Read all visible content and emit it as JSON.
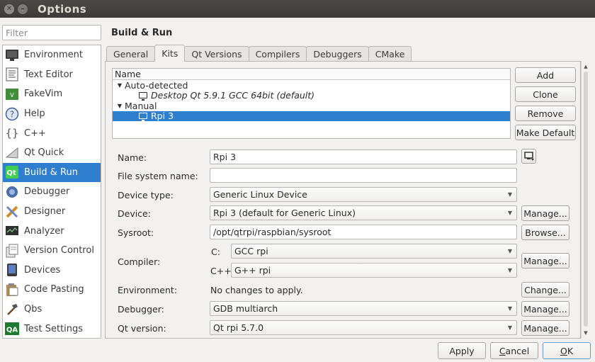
{
  "window": {
    "title": "Options",
    "close_glyph": "✕",
    "minimize_glyph": "–"
  },
  "filter": {
    "placeholder": "Filter"
  },
  "sidebar": {
    "items": [
      {
        "label": "Environment",
        "icon": "monitor-icon"
      },
      {
        "label": "Text Editor",
        "icon": "text-document-icon"
      },
      {
        "label": "FakeVim",
        "icon": "fakevim-icon"
      },
      {
        "label": "Help",
        "icon": "help-icon"
      },
      {
        "label": "C++",
        "icon": "braces-icon"
      },
      {
        "label": "Qt Quick",
        "icon": "qt-quick-icon"
      },
      {
        "label": "Build & Run",
        "icon": "qt-build-icon",
        "selected": true
      },
      {
        "label": "Debugger",
        "icon": "debugger-icon"
      },
      {
        "label": "Designer",
        "icon": "designer-icon"
      },
      {
        "label": "Analyzer",
        "icon": "analyzer-icon"
      },
      {
        "label": "Version Control",
        "icon": "version-control-icon"
      },
      {
        "label": "Devices",
        "icon": "devices-icon"
      },
      {
        "label": "Code Pasting",
        "icon": "code-pasting-icon"
      },
      {
        "label": "Qbs",
        "icon": "qbs-icon"
      },
      {
        "label": "Test Settings",
        "icon": "qa-icon"
      }
    ]
  },
  "page": {
    "title": "Build & Run"
  },
  "tabs": [
    {
      "label": "General"
    },
    {
      "label": "Kits",
      "active": true
    },
    {
      "label": "Qt Versions"
    },
    {
      "label": "Compilers"
    },
    {
      "label": "Debuggers"
    },
    {
      "label": "CMake"
    }
  ],
  "kits": {
    "header": "Name",
    "groups": [
      {
        "label": "Auto-detected",
        "children": [
          "Desktop Qt 5.9.1 GCC 64bit (default)"
        ]
      },
      {
        "label": "Manual",
        "children": [
          "Rpi 3"
        ]
      }
    ],
    "buttons": {
      "add": "Add",
      "clone": "Clone",
      "remove": "Remove",
      "make_default": "Make Default"
    }
  },
  "form": {
    "name": {
      "label": "Name:",
      "value": "Rpi 3"
    },
    "fs_name": {
      "label": "File system name:",
      "value": ""
    },
    "device_type": {
      "label": "Device type:",
      "value": "Generic Linux Device"
    },
    "device": {
      "label": "Device:",
      "value": "Rpi 3 (default for Generic Linux)",
      "button": "Manage..."
    },
    "sysroot": {
      "label": "Sysroot:",
      "value": "/opt/qtrpi/raspbian/sysroot",
      "button": "Browse..."
    },
    "compiler": {
      "label": "Compiler:",
      "c_label": "C:",
      "c_value": "GCC rpi",
      "cpp_label": "C++:",
      "cpp_value": "G++ rpi",
      "button": "Manage..."
    },
    "environment": {
      "label": "Environment:",
      "value": "No changes to apply.",
      "button": "Change..."
    },
    "debugger": {
      "label": "Debugger:",
      "value": "GDB multiarch",
      "button": "Manage..."
    },
    "qt_version": {
      "label": "Qt version:",
      "value": "Qt rpi 5.7.0",
      "button": "Manage..."
    }
  },
  "footer": {
    "apply": "Apply",
    "cancel_accel": "C",
    "cancel_rest": "ancel",
    "ok_accel": "O",
    "ok_rest": "K"
  },
  "colors": {
    "accent": "#2f7fd1",
    "titlebar": "#3c3b37",
    "window_bg": "#f2f1f0"
  }
}
